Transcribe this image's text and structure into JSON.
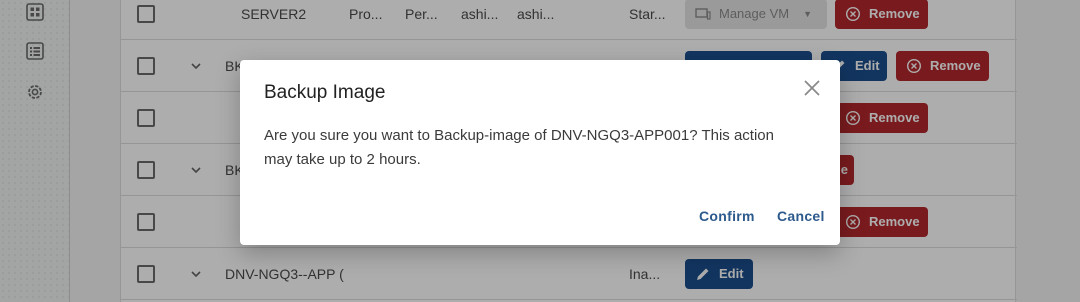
{
  "sidebar": {
    "icons": [
      "dashboard-icon",
      "list-icon",
      "gear-icon"
    ]
  },
  "rows": [
    {
      "name": "SERVER2",
      "col2": "Pro...",
      "col3": "Per...",
      "col4": "ashi...",
      "col5": "ashi...",
      "status": "Star...",
      "manage_label": "Manage VM",
      "remove_label": "Remove"
    },
    {
      "name": "BK",
      "edit_label": "Edit",
      "remove_label": "Remove"
    },
    {
      "remove_label": "Remove"
    },
    {
      "name": "BK",
      "remove_partial": "e"
    },
    {
      "remove_label": "Remove"
    },
    {
      "name": "DNV-NGQ3--APP (",
      "status": "Ina...",
      "edit_label": "Edit"
    }
  ],
  "dialog": {
    "title": "Backup Image",
    "message_line1": "Are you sure you want to Backup-image of DNV-NGQ3-APP001? This action",
    "message_line2": "may take up to 2 hours.",
    "confirm_label": "Confirm",
    "cancel_label": "Cancel"
  },
  "colors": {
    "remove": "#b3282d",
    "edit": "#1b4f8e",
    "dialog_action": "#2d5a8c"
  }
}
